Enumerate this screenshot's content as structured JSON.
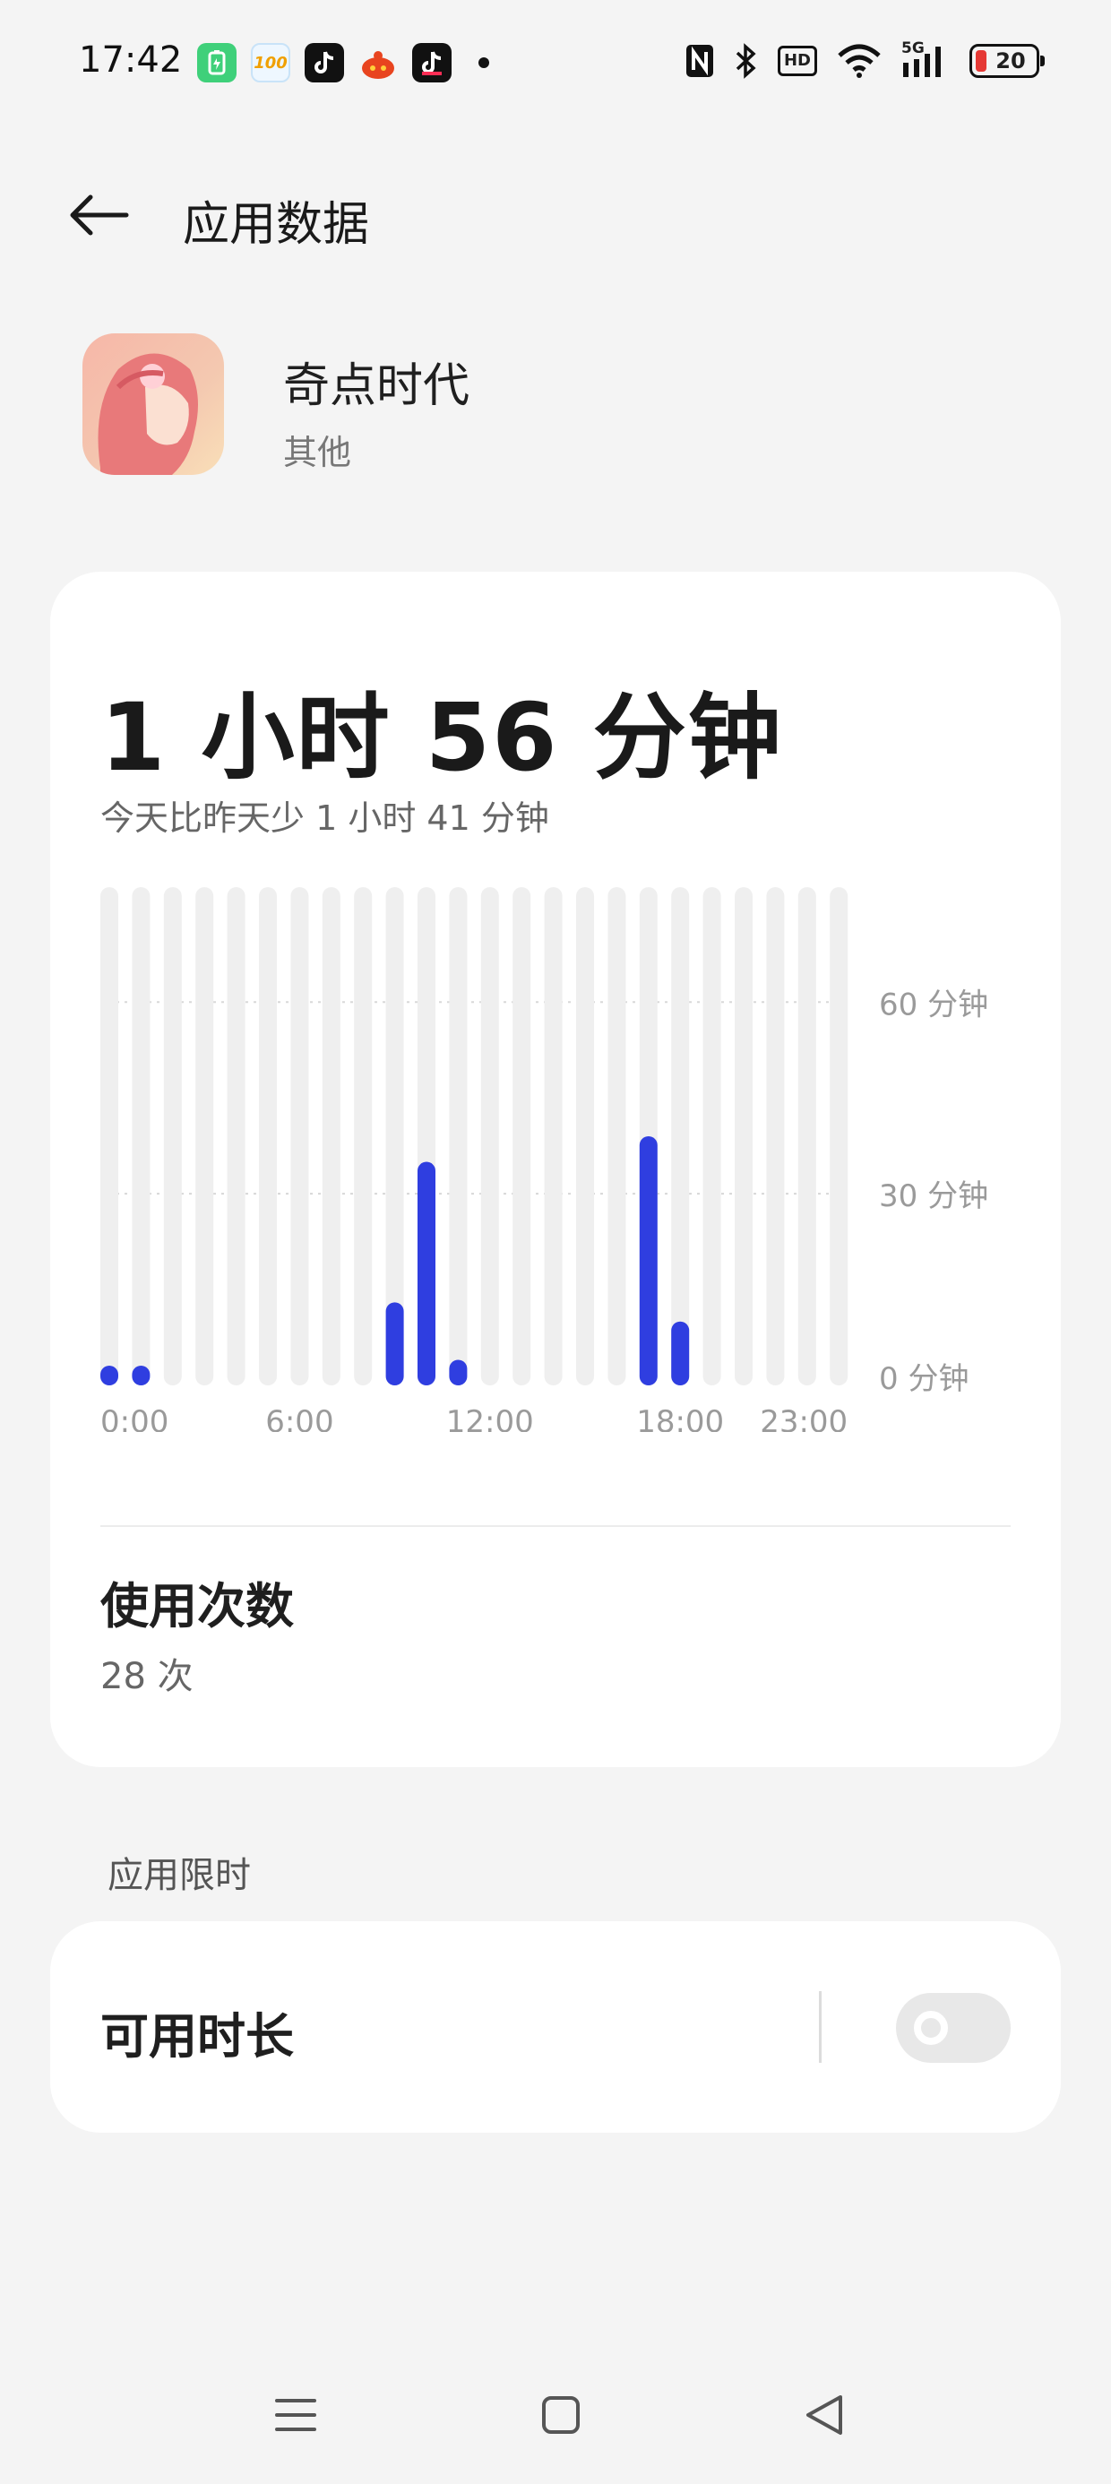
{
  "status_bar": {
    "time": "17:42",
    "notification_icons": [
      "battery-saver-icon",
      "homework-100-icon",
      "tiktok-icon",
      "orange-app-icon",
      "tiktok-lite-icon"
    ],
    "network": "5G",
    "battery_level": "20",
    "hd_label": "HD"
  },
  "header": {
    "title": "应用数据"
  },
  "app": {
    "name": "奇点时代",
    "category": "其他"
  },
  "usage": {
    "total": "1 小时 56 分钟",
    "comparison": "今天比昨天少 1 小时 41 分钟",
    "open_count_label": "使用次数",
    "open_count_value": "28 次"
  },
  "chart_data": {
    "type": "bar",
    "categories": [
      "0:00",
      "1:00",
      "2:00",
      "3:00",
      "4:00",
      "5:00",
      "6:00",
      "7:00",
      "8:00",
      "9:00",
      "10:00",
      "11:00",
      "12:00",
      "13:00",
      "14:00",
      "15:00",
      "16:00",
      "17:00",
      "18:00",
      "19:00",
      "20:00",
      "21:00",
      "22:00",
      "23:00"
    ],
    "values": [
      2,
      3,
      0,
      0,
      0,
      0,
      0,
      0,
      0,
      13,
      35,
      4,
      0,
      0,
      0,
      0,
      0,
      39,
      10,
      0,
      0,
      0,
      0,
      0
    ],
    "x_tick_labels": [
      "0:00",
      "6:00",
      "12:00",
      "18:00",
      "23:00"
    ],
    "y_tick_labels": [
      "60 分钟",
      "30 分钟",
      "0 分钟"
    ],
    "y_ticks": [
      60,
      30,
      0
    ],
    "ylim": [
      0,
      78
    ],
    "bar_color": "#2f3ee0",
    "track_color": "#efefef",
    "grid": "dotted horizontal at 30 and 60"
  },
  "limit_section": {
    "title": "应用限时",
    "item_label": "可用时长",
    "enabled": false
  },
  "colors": {
    "background": "#f4f4f4",
    "card": "#ffffff",
    "accent_bar": "#2f3ee0"
  }
}
